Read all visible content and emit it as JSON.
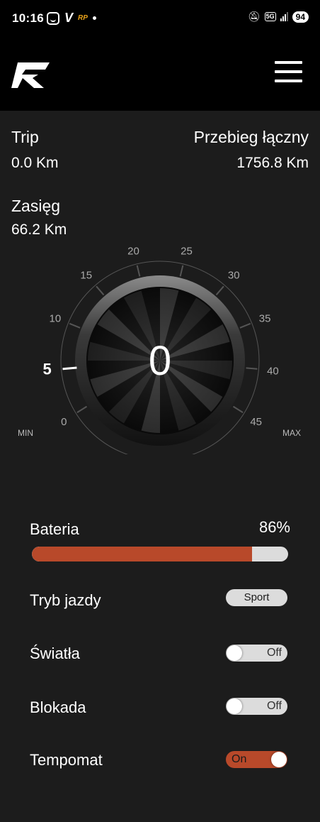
{
  "status_bar": {
    "time": "10:16",
    "carrier_glyph": "V",
    "app_badge": "RP",
    "network": "5G",
    "battery": "94"
  },
  "stats": {
    "trip_label": "Trip",
    "trip_value": "0.0 Km",
    "total_label": "Przebieg łączny",
    "total_value": "1756.8 Km",
    "range_label": "Zasięg",
    "range_value": "66.2 Km"
  },
  "gauge": {
    "speed": "0",
    "current_value": 5,
    "min_label": "MIN",
    "max_label": "MAX",
    "ticks": [
      "0",
      "5",
      "10",
      "15",
      "20",
      "25",
      "30",
      "35",
      "40",
      "45"
    ]
  },
  "battery": {
    "label": "Bateria",
    "percent_text": "86%",
    "level": 0.86,
    "fill_color": "#b8492a"
  },
  "controls": {
    "mode_label": "Tryb jazdy",
    "mode_value": "Sport",
    "lights_label": "Światła",
    "lights_state": "Off",
    "lock_label": "Blokada",
    "lock_state": "Off",
    "cruise_label": "Tempomat",
    "cruise_state": "On"
  },
  "colors": {
    "accent": "#b8492a",
    "background": "#1c1c1c",
    "header": "#000000"
  }
}
